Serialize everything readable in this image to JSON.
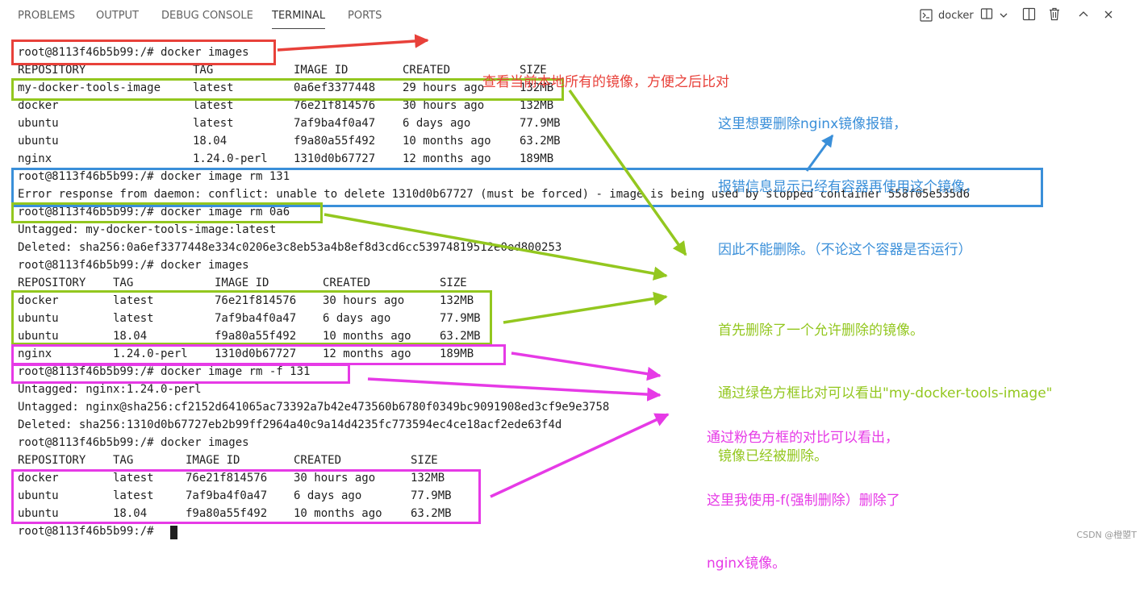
{
  "panel": {
    "tabs": [
      "PROBLEMS",
      "OUTPUT",
      "DEBUG CONSOLE",
      "TERMINAL",
      "PORTS"
    ],
    "active_tab": "TERMINAL",
    "terminal_name": "docker",
    "icons": [
      "terminal-icon",
      "split-terminal-icon",
      "chevron-down-icon",
      "panel-layout-icon",
      "trash-icon",
      "chevron-up-icon",
      "close-icon"
    ]
  },
  "terminal": {
    "lines": [
      {
        "text": "root@8113f46b5b99:/# docker images"
      },
      {
        "cells": [
          "REPOSITORY",
          "TAG",
          "IMAGE ID",
          "CREATED",
          "SIZE"
        ]
      },
      {
        "cells": [
          "my-docker-tools-image",
          "latest",
          "0a6ef3377448",
          "29 hours ago",
          "132MB"
        ]
      },
      {
        "cells": [
          "docker",
          "latest",
          "76e21f814576",
          "30 hours ago",
          "132MB"
        ]
      },
      {
        "cells": [
          "ubuntu",
          "latest",
          "7af9ba4f0a47",
          "6 days ago",
          "77.9MB"
        ]
      },
      {
        "cells": [
          "ubuntu",
          "18.04",
          "f9a80a55f492",
          "10 months ago",
          "63.2MB"
        ]
      },
      {
        "cells": [
          "nginx",
          "1.24.0-perl",
          "1310d0b67727",
          "12 months ago",
          "189MB"
        ]
      },
      {
        "text": "root@8113f46b5b99:/# docker image rm 131"
      },
      {
        "text": "Error response from daemon: conflict: unable to delete 1310d0b67727 (must be forced) - image is being used by stopped container 558f05e535d6"
      },
      {
        "text": "root@8113f46b5b99:/# docker image rm 0a6"
      },
      {
        "text": "Untagged: my-docker-tools-image:latest"
      },
      {
        "text": "Deleted: sha256:0a6ef3377448e334c0206e3c8eb53a4b8ef8d3cd6cc53974819512e0ed800253"
      },
      {
        "text": "root@8113f46b5b99:/# docker images"
      },
      {
        "cells": [
          "REPOSITORY",
          "TAG",
          "IMAGE ID",
          "CREATED",
          "SIZE"
        ]
      },
      {
        "cells": [
          "docker",
          "latest",
          "76e21f814576",
          "30 hours ago",
          "132MB"
        ]
      },
      {
        "cells": [
          "ubuntu",
          "latest",
          "7af9ba4f0a47",
          "6 days ago",
          "77.9MB"
        ]
      },
      {
        "cells": [
          "ubuntu",
          "18.04",
          "f9a80a55f492",
          "10 months ago",
          "63.2MB"
        ]
      },
      {
        "cells": [
          "nginx",
          "1.24.0-perl",
          "1310d0b67727",
          "12 months ago",
          "189MB"
        ]
      },
      {
        "text": "root@8113f46b5b99:/# docker image rm -f 131"
      },
      {
        "text": "Untagged: nginx:1.24.0-perl"
      },
      {
        "text": "Untagged: nginx@sha256:cf2152d641065ac73392a7b42e473560b6780f0349bc9091908ed3cf9e9e3758"
      },
      {
        "text": "Deleted: sha256:1310d0b67727eb2b99ff2964a40c9a14d4235fc773594ec4ce18acf2ede63f4d"
      },
      {
        "text": "root@8113f46b5b99:/# docker images"
      },
      {
        "cells": [
          "REPOSITORY",
          "TAG",
          "IMAGE ID",
          "CREATED",
          "SIZE"
        ]
      },
      {
        "cells": [
          "docker",
          "latest",
          "76e21f814576",
          "30 hours ago",
          "132MB"
        ]
      },
      {
        "cells": [
          "ubuntu",
          "latest",
          "7af9ba4f0a47",
          "6 days ago",
          "77.9MB"
        ]
      },
      {
        "cells": [
          "ubuntu",
          "18.04",
          "f9a80a55f492",
          "10 months ago",
          "63.2MB"
        ]
      },
      {
        "text": "root@8113f46b5b99:/# "
      }
    ]
  },
  "annotations": {
    "red": [
      "查看当前本地所有的镜像，方便之后比对"
    ],
    "blue": [
      "这里想要删除nginx镜像报错，",
      "报错信息显示已经有容器再使用这个镜像，",
      "因此不能删除。（不论这个容器是否运行）"
    ],
    "green": [
      "首先删除了一个允许删除的镜像。",
      "通过绿色方框比对可以看出\"my-docker-tools-image\"",
      "镜像已经被删除。"
    ],
    "magenta": [
      "通过粉色方框的对比可以看出，",
      "这里我使用-f(强制删除）删除了",
      "nginx镜像。"
    ]
  },
  "colors": {
    "red": "#e8413a",
    "blue": "#3a8fd9",
    "green": "#93c71f",
    "magenta": "#e63ae6",
    "terminal_text": "#1f1f1f"
  },
  "watermark": "CSDN @橙曌T"
}
